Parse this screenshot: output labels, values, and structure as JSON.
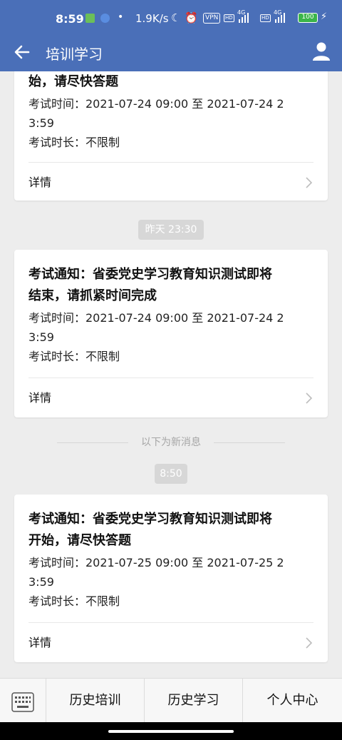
{
  "status_bar": {
    "time": "8:59",
    "net_speed": "1.9K/s",
    "vpn": "VPN",
    "hd": "HD",
    "net_type": "4G",
    "battery": "100",
    "colors": {
      "background": "#4a6fb8",
      "battery": "#3bb54a"
    }
  },
  "header": {
    "title": "培训学习",
    "back_icon": "arrow-left-icon",
    "user_icon": "user-icon"
  },
  "messages": [
    {
      "title_line2": "始，请尽快答题",
      "exam_time_line1": "考试时间：2021-07-24 09:00 至 2021-07-24 2",
      "exam_time_line2": "3:59",
      "duration": "考试时长：不限制",
      "detail_label": "详情"
    },
    {
      "timestamp": "昨天 23:30",
      "title_line1": "考试通知：省委党史学习教育知识测试即将",
      "title_line2": "结束，请抓紧时间完成",
      "exam_time_line1": "考试时间：2021-07-24 09:00 至 2021-07-24 2",
      "exam_time_line2": "3:59",
      "duration": "考试时长：不限制",
      "detail_label": "详情"
    },
    {
      "timestamp": "8:50",
      "title_line1": "考试通知：省委党史学习教育知识测试即将",
      "title_line2": "开始，请尽快答题",
      "exam_time_line1": "考试时间：2021-07-25 09:00 至 2021-07-25 2",
      "exam_time_line2": "3:59",
      "duration": "考试时长：不限制",
      "detail_label": "详情"
    }
  ],
  "new_message_separator": "以下为新消息",
  "bottom_bar": {
    "keyboard_icon": "keyboard-icon",
    "tabs": [
      "历史培训",
      "历史学习",
      "个人中心"
    ]
  }
}
